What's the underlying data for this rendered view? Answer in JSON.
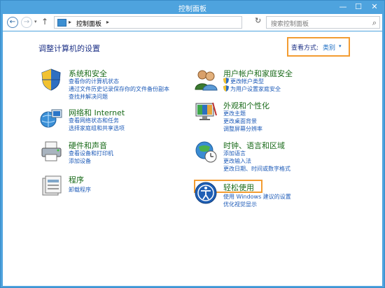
{
  "window": {
    "title": "控制面板",
    "min_glyph": "—",
    "max_glyph": "☐",
    "close_glyph": "✕"
  },
  "nav": {
    "back_glyph": "←",
    "forward_glyph": "→",
    "dropdown_glyph": "▾",
    "up_glyph": "↑",
    "breadcrumb_separator": "▸",
    "breadcrumb": "控制面板",
    "refresh_glyph": "↻",
    "search_placeholder": "搜索控制面板",
    "search_glyph": "⌕"
  },
  "main": {
    "heading": "调整计算机的设置",
    "view_by_label": "查看方式:",
    "view_by_value": "类别",
    "view_by_arrow": "▾"
  },
  "categories": {
    "system": {
      "title": "系统和安全",
      "links": [
        "查看你的计算机状态",
        "通过文件历史记录保存你的文件备份副本",
        "查找并解决问题"
      ]
    },
    "network": {
      "title": "网络和 Internet",
      "links": [
        "查看网络状态和任务",
        "选择家庭组和共享选项"
      ]
    },
    "hardware": {
      "title": "硬件和声音",
      "links": [
        "查看设备和打印机",
        "添加设备"
      ]
    },
    "programs": {
      "title": "程序",
      "links": [
        "卸载程序"
      ]
    },
    "user": {
      "title": "用户帐户和家庭安全",
      "links": [
        "更改帐户类型",
        "为用户设置家庭安全"
      ]
    },
    "appearance": {
      "title": "外观和个性化",
      "links": [
        "更改主题",
        "更改桌面背景",
        "调整屏幕分辨率"
      ]
    },
    "clock": {
      "title": "时钟、语言和区域",
      "links": [
        "添加语言",
        "更改输入法",
        "更改日期、时间或数字格式"
      ]
    },
    "ease": {
      "title": "轻松使用",
      "links": [
        "使用 Windows 建议的设置",
        "优化视觉显示"
      ]
    }
  },
  "colors": {
    "accent": "#1e5bb8",
    "category_title": "#1a6b1a",
    "highlight": "#f39c31",
    "titlebar": "#4ea3de"
  }
}
